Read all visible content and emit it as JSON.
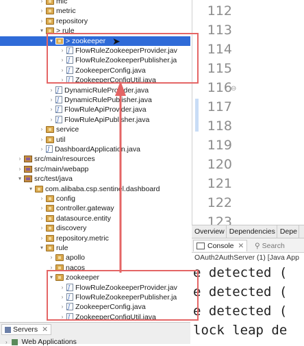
{
  "tree": [
    {
      "label": "mic",
      "icon": "package",
      "twisty": "›",
      "indent": 56
    },
    {
      "label": "metric",
      "icon": "package",
      "twisty": "›",
      "indent": 56
    },
    {
      "label": "repository",
      "icon": "package",
      "twisty": "›",
      "indent": 56
    },
    {
      "label": "> rule",
      "icon": "package",
      "twisty": "▾",
      "indent": 56
    },
    {
      "label": "> zookeeper",
      "icon": "package",
      "twisty": "▾",
      "indent": 70,
      "selected": true
    },
    {
      "label": "FlowRuleZookeeperProvider.jav",
      "icon": "java",
      "twisty": "›",
      "indent": 86
    },
    {
      "label": "FlowRuleZookeeperPublisher.ja",
      "icon": "java",
      "twisty": "›",
      "indent": 86
    },
    {
      "label": "ZookeeperConfig.java",
      "icon": "java",
      "twisty": "›",
      "indent": 86
    },
    {
      "label": "ZookeeperConfigUtil.java",
      "icon": "java",
      "twisty": "›",
      "indent": 86
    },
    {
      "label": "DynamicRuleProvider.java",
      "icon": "java",
      "twisty": "›",
      "indent": 70
    },
    {
      "label": "DynamicRulePublisher.java",
      "icon": "java",
      "twisty": "›",
      "indent": 70
    },
    {
      "label": "FlowRuleApiProvider.java",
      "icon": "java",
      "twisty": "›",
      "indent": 70
    },
    {
      "label": "FlowRuleApiPublisher.java",
      "icon": "java",
      "twisty": "›",
      "indent": 70
    },
    {
      "label": "service",
      "icon": "package",
      "twisty": "›",
      "indent": 56
    },
    {
      "label": "util",
      "icon": "package",
      "twisty": "›",
      "indent": 56
    },
    {
      "label": "DashboardApplication.java",
      "icon": "java",
      "twisty": "›",
      "indent": 56
    },
    {
      "label": "src/main/resources",
      "icon": "source",
      "twisty": "›",
      "indent": 24
    },
    {
      "label": "src/main/webapp",
      "icon": "source",
      "twisty": "›",
      "indent": 24
    },
    {
      "label": "src/test/java",
      "icon": "source",
      "twisty": "▾",
      "indent": 24
    },
    {
      "label": "com.alibaba.csp.sentinel.dashboard",
      "icon": "package",
      "twisty": "▾",
      "indent": 40
    },
    {
      "label": "config",
      "icon": "package",
      "twisty": "›",
      "indent": 56
    },
    {
      "label": "controller.gateway",
      "icon": "package",
      "twisty": "›",
      "indent": 56
    },
    {
      "label": "datasource.entity",
      "icon": "package",
      "twisty": "›",
      "indent": 56
    },
    {
      "label": "discovery",
      "icon": "package",
      "twisty": "›",
      "indent": 56
    },
    {
      "label": "repository.metric",
      "icon": "package",
      "twisty": "›",
      "indent": 56
    },
    {
      "label": "rule",
      "icon": "package",
      "twisty": "▾",
      "indent": 56
    },
    {
      "label": "apollo",
      "icon": "package",
      "twisty": "›",
      "indent": 70
    },
    {
      "label": "nacos",
      "icon": "package",
      "twisty": "›",
      "indent": 70
    },
    {
      "label": "zookeeper",
      "icon": "package",
      "twisty": "▾",
      "indent": 70
    },
    {
      "label": "FlowRuleZookeeperProvider.jav",
      "icon": "java",
      "twisty": "›",
      "indent": 86
    },
    {
      "label": "FlowRuleZookeeperPublisher.ja",
      "icon": "java",
      "twisty": "›",
      "indent": 86
    },
    {
      "label": "ZookeeperConfig.java",
      "icon": "java",
      "twisty": "›",
      "indent": 86
    },
    {
      "label": "ZookeeperConfigUtil.java",
      "icon": "java",
      "twisty": "›",
      "indent": 86
    }
  ],
  "editor": {
    "line_numbers": [
      "112",
      "113",
      "114",
      "115",
      "116",
      "117",
      "118",
      "119",
      "120",
      "121",
      "122",
      "123"
    ],
    "fold_marker": "⊖"
  },
  "bottom_tabs": [
    "Overview",
    "Dependencies",
    "Depe"
  ],
  "console": {
    "tab_label": "Console",
    "close_glyph": "✕",
    "search_label": "Search",
    "title": "OAuth2AuthServer (1) [Java App",
    "lines": [
      "e detected (",
      "e detected (",
      "e detected (",
      "lock leap de",
      "e detected ("
    ]
  },
  "servers": {
    "tab_label": "Servers",
    "close_glyph": "✕",
    "item": "Web Applications"
  },
  "colors": {
    "annotation": "#e46565",
    "selection": "#2f6bd8"
  }
}
